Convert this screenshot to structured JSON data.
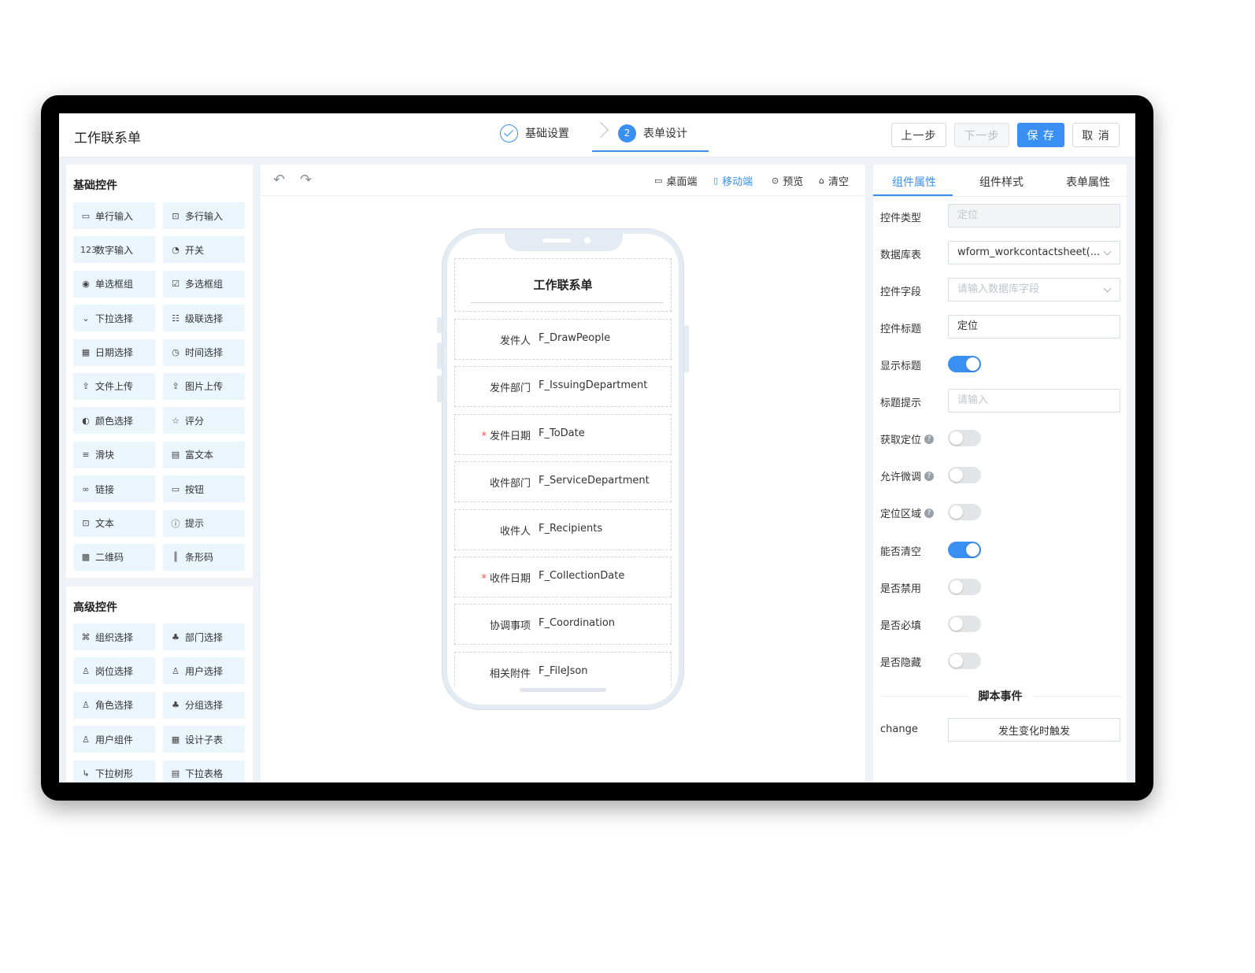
{
  "header": {
    "title": "工作联系单",
    "steps": [
      {
        "label": "基础设置",
        "state": "done"
      },
      {
        "label": "表单设计",
        "number": "2",
        "state": "active"
      }
    ],
    "buttons": {
      "prev": "上一步",
      "next": "下一步",
      "save": "保 存",
      "cancel": "取 消"
    }
  },
  "left": {
    "basic_title": "基础控件",
    "basic": [
      {
        "icon": "▭",
        "label": "单行输入"
      },
      {
        "icon": "⊡",
        "label": "多行输入"
      },
      {
        "icon": "123",
        "label": "数字输入"
      },
      {
        "icon": "◔",
        "label": "开关"
      },
      {
        "icon": "◉",
        "label": "单选框组"
      },
      {
        "icon": "☑",
        "label": "多选框组"
      },
      {
        "icon": "⌄",
        "label": "下拉选择"
      },
      {
        "icon": "☷",
        "label": "级联选择"
      },
      {
        "icon": "▦",
        "label": "日期选择"
      },
      {
        "icon": "◷",
        "label": "时间选择"
      },
      {
        "icon": "⇪",
        "label": "文件上传"
      },
      {
        "icon": "⇪",
        "label": "图片上传"
      },
      {
        "icon": "◐",
        "label": "颜色选择"
      },
      {
        "icon": "☆",
        "label": "评分"
      },
      {
        "icon": "≡",
        "label": "滑块"
      },
      {
        "icon": "▤",
        "label": "富文本"
      },
      {
        "icon": "∞",
        "label": "链接"
      },
      {
        "icon": "▭",
        "label": "按钮"
      },
      {
        "icon": "⊡",
        "label": "文本"
      },
      {
        "icon": "ⓘ",
        "label": "提示"
      },
      {
        "icon": "▩",
        "label": "二维码"
      },
      {
        "icon": "║",
        "label": "条形码"
      }
    ],
    "advanced_title": "高级控件",
    "advanced": [
      {
        "icon": "⌘",
        "label": "组织选择"
      },
      {
        "icon": "♣",
        "label": "部门选择"
      },
      {
        "icon": "♙",
        "label": "岗位选择"
      },
      {
        "icon": "♙",
        "label": "用户选择"
      },
      {
        "icon": "♙",
        "label": "角色选择"
      },
      {
        "icon": "♣",
        "label": "分组选择"
      },
      {
        "icon": "♙",
        "label": "用户组件"
      },
      {
        "icon": "▦",
        "label": "设计子表"
      },
      {
        "icon": "↳",
        "label": "下拉树形"
      },
      {
        "icon": "▤",
        "label": "下拉表格"
      }
    ]
  },
  "toolbar": {
    "desktop": "桌面端",
    "mobile": "移动端",
    "preview": "预览",
    "clear": "清空"
  },
  "form": {
    "title": "工作联系单",
    "fields": [
      {
        "label": "发件人",
        "value": "F_DrawPeople",
        "required": false
      },
      {
        "label": "发件部门",
        "value": "F_IssuingDepartment",
        "required": false
      },
      {
        "label": "发件日期",
        "value": "F_ToDate",
        "required": true
      },
      {
        "label": "收件部门",
        "value": "F_ServiceDepartment",
        "required": false
      },
      {
        "label": "收件人",
        "value": "F_Recipients",
        "required": false
      },
      {
        "label": "收件日期",
        "value": "F_CollectionDate",
        "required": true
      },
      {
        "label": "协调事项",
        "value": "F_Coordination",
        "required": false
      },
      {
        "label": "相关附件",
        "value": "F_FileJson",
        "required": false
      }
    ]
  },
  "right": {
    "tabs": [
      "组件属性",
      "组件样式",
      "表单属性"
    ],
    "props": {
      "type_label": "控件类型",
      "type_value": "定位",
      "table_label": "数据库表",
      "table_value": "wform_workcontactsheet(...",
      "field_label": "控件字段",
      "field_placeholder": "请输入数据库字段",
      "title_label": "控件标题",
      "title_value": "定位",
      "show_title_label": "显示标题",
      "show_title": true,
      "tip_label": "标题提示",
      "tip_placeholder": "请输入",
      "get_loc_label": "获取定位",
      "get_loc": false,
      "fine_tune_label": "允许微调",
      "fine_tune": false,
      "area_label": "定位区域",
      "area": false,
      "clearable_label": "能否清空",
      "clearable": true,
      "disabled_label": "是否禁用",
      "disabled": false,
      "required_label": "是否必填",
      "required": false,
      "hidden_label": "是否隐藏",
      "hidden": false
    },
    "script_title": "脚本事件",
    "event_name": "change",
    "event_button": "发生变化时触发"
  },
  "help_glyph": "?"
}
